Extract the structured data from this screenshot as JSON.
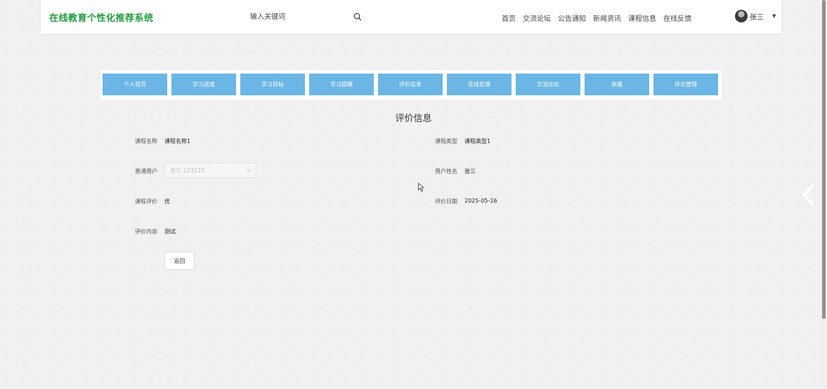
{
  "header": {
    "logo": "在线教育个性化推荐系统",
    "search_placeholder": "输入关键词",
    "nav": [
      "首页",
      "交流论坛",
      "公告通知",
      "新闻资讯",
      "课程信息",
      "在线反馈"
    ],
    "user_name": "张三"
  },
  "tabs": [
    "个人首页",
    "学习进度",
    "学习目标",
    "学习提醒",
    "评价信息",
    "在线反馈",
    "交流论坛",
    "收藏",
    "评论管理"
  ],
  "page_title": "评价信息",
  "form": {
    "course_name_label": "课程名称",
    "course_name_value": "课程名称1",
    "course_type_label": "课程类型",
    "course_type_value": "课程类型1",
    "user_label": "普通用户",
    "user_select_value": "张三  123123",
    "user_name_label": "用户姓名",
    "user_name_value": "张三",
    "rating_label": "课程评价",
    "rating_value": "优",
    "date_label": "评价日期",
    "date_value": "2025-05-16",
    "content_label": "评价内容",
    "content_value": "测试",
    "back_label": "返回"
  },
  "colors": {
    "logo": "#1f9d3c",
    "tab_bg": "#6bb6e5",
    "page_bg": "#f1f1f1"
  }
}
